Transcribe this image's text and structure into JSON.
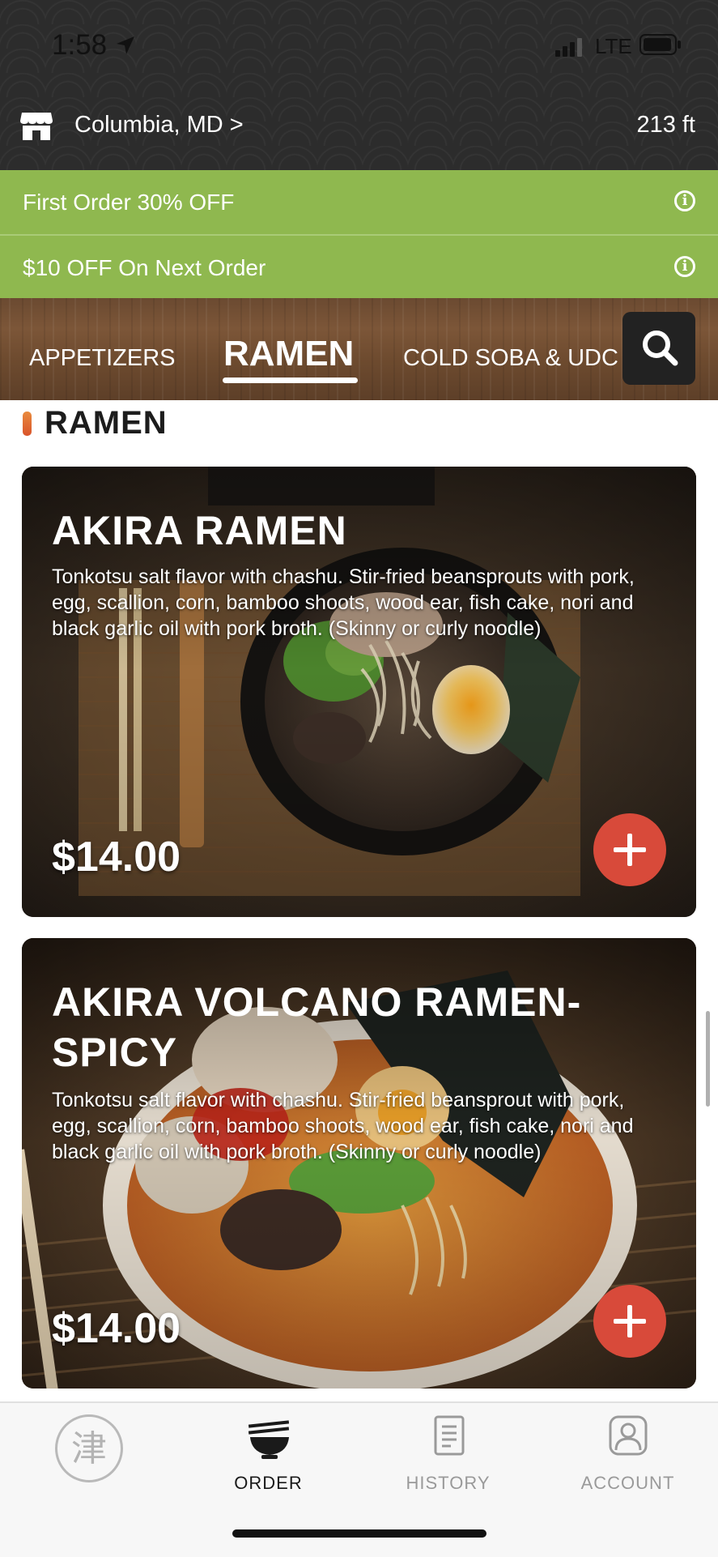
{
  "status": {
    "time": "1:58",
    "carrier": "LTE"
  },
  "location": {
    "label": "Columbia, MD >",
    "distance": "213 ft"
  },
  "promos": [
    {
      "text": "First Order 30% OFF"
    },
    {
      "text": "$10 OFF On Next Order"
    }
  ],
  "tabs": [
    {
      "label": "APPETIZERS"
    },
    {
      "label": "RAMEN"
    },
    {
      "label": "COLD SOBA & UDC"
    }
  ],
  "section": {
    "title": "RAMEN"
  },
  "items": [
    {
      "title": "AKIRA RAMEN",
      "description": "Tonkotsu salt flavor with chashu. Stir-fried beansprouts with pork, egg, scallion, corn, bamboo shoots, wood ear, fish cake, nori and black garlic oil with pork broth. (Skinny or curly noodle)",
      "price": "$14.00"
    },
    {
      "title": "AKIRA VOLCANO RAMEN-SPICY",
      "description": "Tonkotsu salt flavor with chashu. Stir-fried beansprout with pork, egg, scallion, corn, bamboo shoots, wood ear, fish cake, nori and black garlic oil with pork broth. (Skinny or curly noodle)",
      "price": "$14.00"
    }
  ],
  "nav": [
    {
      "label": "",
      "icon": "logo-icon"
    },
    {
      "label": "ORDER",
      "icon": "ramen-bowl-icon",
      "active": true
    },
    {
      "label": "HISTORY",
      "icon": "receipt-icon"
    },
    {
      "label": "ACCOUNT",
      "icon": "person-icon"
    }
  ],
  "colors": {
    "promo": "#8fb84f",
    "add_button": "#d84a3a",
    "active_nav": "#1a1a1a",
    "inactive_nav": "#9a9a9a"
  }
}
